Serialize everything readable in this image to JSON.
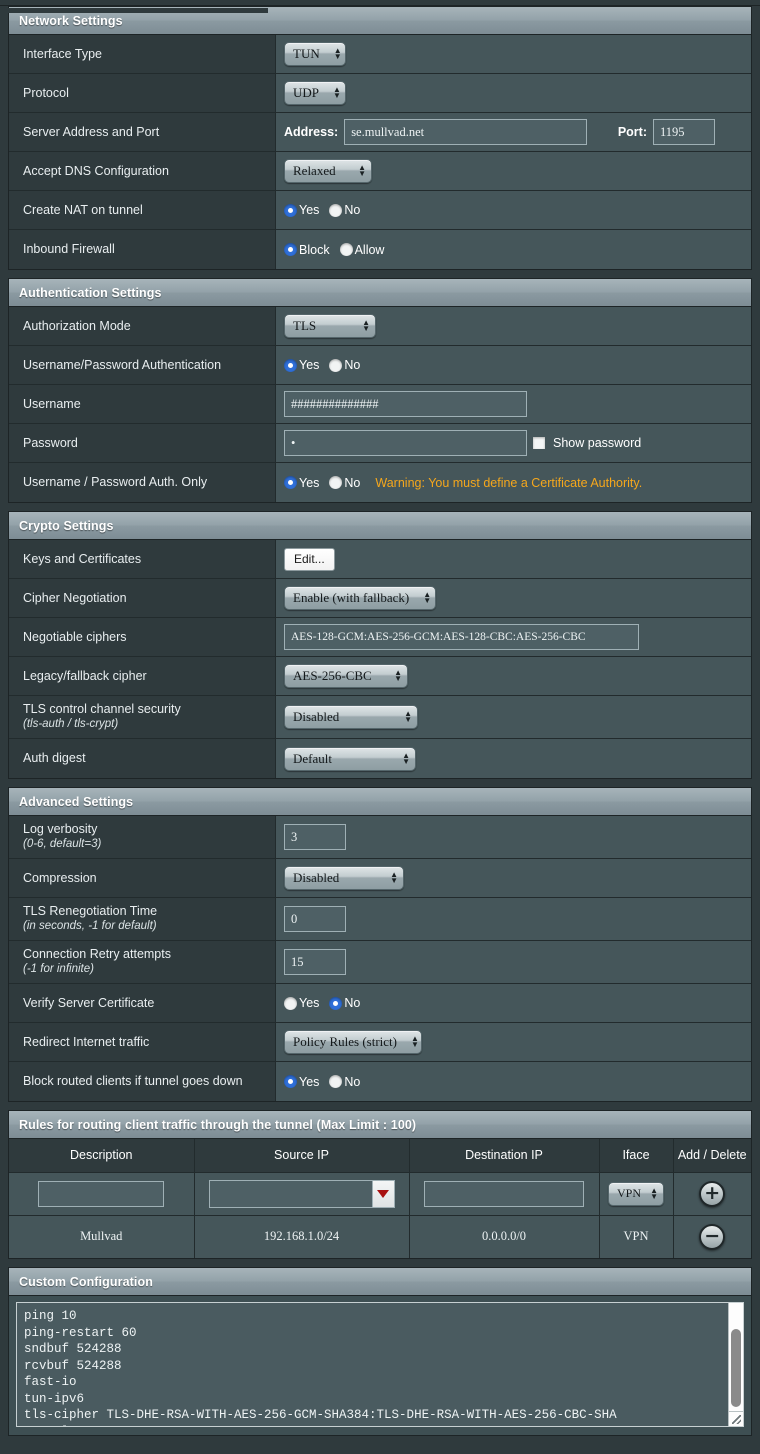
{
  "sections": {
    "network": {
      "title": "Network Settings",
      "rows": {
        "interface_type": {
          "label": "Interface Type",
          "value": "TUN"
        },
        "protocol": {
          "label": "Protocol",
          "value": "UDP"
        },
        "server": {
          "label": "Server Address and Port",
          "address_label": "Address:",
          "address_value": "se.mullvad.net",
          "port_label": "Port:",
          "port_value": "1195"
        },
        "dns": {
          "label": "Accept DNS Configuration",
          "value": "Relaxed"
        },
        "nat": {
          "label": "Create NAT on tunnel",
          "yes_label": "Yes",
          "no_label": "No",
          "selected": "Yes"
        },
        "firewall": {
          "label": "Inbound Firewall",
          "block_label": "Block",
          "allow_label": "Allow",
          "selected": "Block"
        }
      }
    },
    "authentication": {
      "title": "Authentication Settings",
      "rows": {
        "auth_mode": {
          "label": "Authorization Mode",
          "value": "TLS"
        },
        "userpass_auth": {
          "label": "Username/Password Authentication",
          "yes_label": "Yes",
          "no_label": "No",
          "selected": "Yes"
        },
        "username": {
          "label": "Username",
          "value": "##############"
        },
        "password": {
          "label": "Password",
          "value": "•",
          "show_password_label": "Show password",
          "show_password_checked": false
        },
        "userpass_only": {
          "label": "Username / Password Auth. Only",
          "yes_label": "Yes",
          "no_label": "No",
          "selected": "Yes",
          "warning": "Warning: You must define a Certificate Authority."
        }
      }
    },
    "crypto": {
      "title": "Crypto Settings",
      "rows": {
        "keys": {
          "label": "Keys and Certificates",
          "button_label": "Edit..."
        },
        "cipher_negotiation": {
          "label": "Cipher Negotiation",
          "value": "Enable (with fallback)"
        },
        "negotiable_ciphers": {
          "label": "Negotiable ciphers",
          "value": "AES-128-GCM:AES-256-GCM:AES-128-CBC:AES-256-CBC"
        },
        "legacy_cipher": {
          "label": "Legacy/fallback cipher",
          "value": "AES-256-CBC"
        },
        "tls_control": {
          "label": "TLS control channel security",
          "sublabel": "(tls-auth / tls-crypt)",
          "value": "Disabled"
        },
        "auth_digest": {
          "label": "Auth digest",
          "value": "Default"
        }
      }
    },
    "advanced": {
      "title": "Advanced Settings",
      "rows": {
        "log_verbosity": {
          "label": "Log verbosity",
          "sublabel": "(0-6, default=3)",
          "value": "3"
        },
        "compression": {
          "label": "Compression",
          "value": "Disabled"
        },
        "tls_reneg": {
          "label": "TLS Renegotiation Time",
          "sublabel": "(in seconds, -1 for default)",
          "value": "0"
        },
        "retry": {
          "label": "Connection Retry attempts",
          "sublabel": "(-1 for infinite)",
          "value": "15"
        },
        "verify_cert": {
          "label": "Verify Server Certificate",
          "yes_label": "Yes",
          "no_label": "No",
          "selected": "No"
        },
        "redirect": {
          "label": "Redirect Internet traffic",
          "value": "Policy Rules (strict)"
        },
        "block_routed": {
          "label": "Block routed clients if tunnel goes down",
          "yes_label": "Yes",
          "no_label": "No",
          "selected": "Yes"
        }
      }
    },
    "routing": {
      "title": "Rules for routing client traffic through the tunnel (Max Limit : 100)",
      "columns": {
        "description": "Description",
        "source_ip": "Source IP",
        "destination_ip": "Destination IP",
        "iface": "Iface",
        "add_delete": "Add / Delete"
      },
      "new_row": {
        "description": "",
        "source_ip": "",
        "destination_ip": "",
        "iface": "VPN",
        "action_icon": "+"
      },
      "entries": [
        {
          "description": "Mullvad",
          "source_ip": "192.168.1.0/24",
          "destination_ip": "0.0.0.0/0",
          "iface": "VPN",
          "action_icon": "−"
        }
      ]
    },
    "custom": {
      "title": "Custom Configuration",
      "content": "ping 10\nping-restart 60\nsndbuf 524288\nrcvbuf 524288\nfast-io\ntun-ipv6\ntls-cipher TLS-DHE-RSA-WITH-AES-256-GCM-SHA384:TLS-DHE-RSA-WITH-AES-256-CBC-SHA\ncomp-lzo no"
    }
  },
  "colors": {
    "label_bg": "#2f3a3d",
    "value_bg": "#45565a",
    "header_gradient_top": "#a7b4ba",
    "radio_selected": "#2f6fd8",
    "warning": "#f5a71c",
    "dropdown_arrow": "#a81010"
  }
}
